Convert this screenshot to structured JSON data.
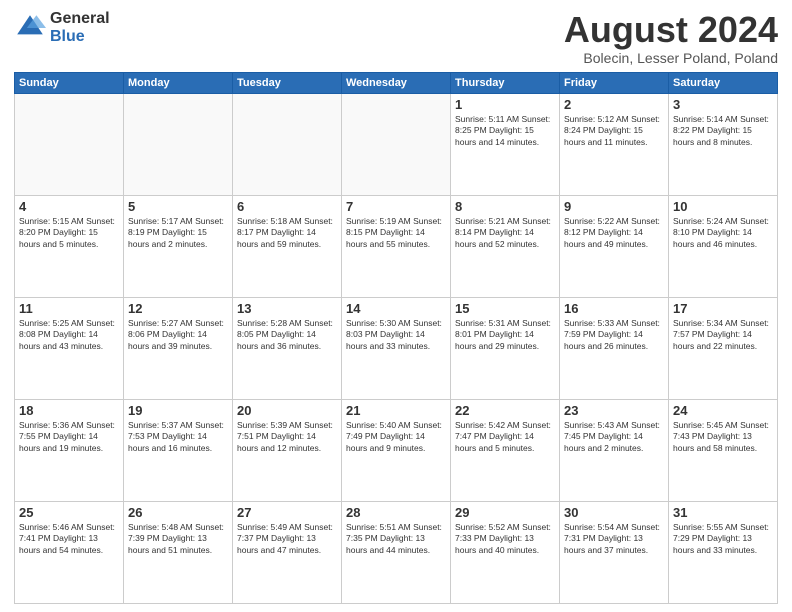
{
  "logo": {
    "general": "General",
    "blue": "Blue"
  },
  "title": {
    "month": "August 2024",
    "location": "Bolecin, Lesser Poland, Poland"
  },
  "weekdays": [
    "Sunday",
    "Monday",
    "Tuesday",
    "Wednesday",
    "Thursday",
    "Friday",
    "Saturday"
  ],
  "weeks": [
    [
      {
        "day": "",
        "info": ""
      },
      {
        "day": "",
        "info": ""
      },
      {
        "day": "",
        "info": ""
      },
      {
        "day": "",
        "info": ""
      },
      {
        "day": "1",
        "info": "Sunrise: 5:11 AM\nSunset: 8:25 PM\nDaylight: 15 hours\nand 14 minutes."
      },
      {
        "day": "2",
        "info": "Sunrise: 5:12 AM\nSunset: 8:24 PM\nDaylight: 15 hours\nand 11 minutes."
      },
      {
        "day": "3",
        "info": "Sunrise: 5:14 AM\nSunset: 8:22 PM\nDaylight: 15 hours\nand 8 minutes."
      }
    ],
    [
      {
        "day": "4",
        "info": "Sunrise: 5:15 AM\nSunset: 8:20 PM\nDaylight: 15 hours\nand 5 minutes."
      },
      {
        "day": "5",
        "info": "Sunrise: 5:17 AM\nSunset: 8:19 PM\nDaylight: 15 hours\nand 2 minutes."
      },
      {
        "day": "6",
        "info": "Sunrise: 5:18 AM\nSunset: 8:17 PM\nDaylight: 14 hours\nand 59 minutes."
      },
      {
        "day": "7",
        "info": "Sunrise: 5:19 AM\nSunset: 8:15 PM\nDaylight: 14 hours\nand 55 minutes."
      },
      {
        "day": "8",
        "info": "Sunrise: 5:21 AM\nSunset: 8:14 PM\nDaylight: 14 hours\nand 52 minutes."
      },
      {
        "day": "9",
        "info": "Sunrise: 5:22 AM\nSunset: 8:12 PM\nDaylight: 14 hours\nand 49 minutes."
      },
      {
        "day": "10",
        "info": "Sunrise: 5:24 AM\nSunset: 8:10 PM\nDaylight: 14 hours\nand 46 minutes."
      }
    ],
    [
      {
        "day": "11",
        "info": "Sunrise: 5:25 AM\nSunset: 8:08 PM\nDaylight: 14 hours\nand 43 minutes."
      },
      {
        "day": "12",
        "info": "Sunrise: 5:27 AM\nSunset: 8:06 PM\nDaylight: 14 hours\nand 39 minutes."
      },
      {
        "day": "13",
        "info": "Sunrise: 5:28 AM\nSunset: 8:05 PM\nDaylight: 14 hours\nand 36 minutes."
      },
      {
        "day": "14",
        "info": "Sunrise: 5:30 AM\nSunset: 8:03 PM\nDaylight: 14 hours\nand 33 minutes."
      },
      {
        "day": "15",
        "info": "Sunrise: 5:31 AM\nSunset: 8:01 PM\nDaylight: 14 hours\nand 29 minutes."
      },
      {
        "day": "16",
        "info": "Sunrise: 5:33 AM\nSunset: 7:59 PM\nDaylight: 14 hours\nand 26 minutes."
      },
      {
        "day": "17",
        "info": "Sunrise: 5:34 AM\nSunset: 7:57 PM\nDaylight: 14 hours\nand 22 minutes."
      }
    ],
    [
      {
        "day": "18",
        "info": "Sunrise: 5:36 AM\nSunset: 7:55 PM\nDaylight: 14 hours\nand 19 minutes."
      },
      {
        "day": "19",
        "info": "Sunrise: 5:37 AM\nSunset: 7:53 PM\nDaylight: 14 hours\nand 16 minutes."
      },
      {
        "day": "20",
        "info": "Sunrise: 5:39 AM\nSunset: 7:51 PM\nDaylight: 14 hours\nand 12 minutes."
      },
      {
        "day": "21",
        "info": "Sunrise: 5:40 AM\nSunset: 7:49 PM\nDaylight: 14 hours\nand 9 minutes."
      },
      {
        "day": "22",
        "info": "Sunrise: 5:42 AM\nSunset: 7:47 PM\nDaylight: 14 hours\nand 5 minutes."
      },
      {
        "day": "23",
        "info": "Sunrise: 5:43 AM\nSunset: 7:45 PM\nDaylight: 14 hours\nand 2 minutes."
      },
      {
        "day": "24",
        "info": "Sunrise: 5:45 AM\nSunset: 7:43 PM\nDaylight: 13 hours\nand 58 minutes."
      }
    ],
    [
      {
        "day": "25",
        "info": "Sunrise: 5:46 AM\nSunset: 7:41 PM\nDaylight: 13 hours\nand 54 minutes."
      },
      {
        "day": "26",
        "info": "Sunrise: 5:48 AM\nSunset: 7:39 PM\nDaylight: 13 hours\nand 51 minutes."
      },
      {
        "day": "27",
        "info": "Sunrise: 5:49 AM\nSunset: 7:37 PM\nDaylight: 13 hours\nand 47 minutes."
      },
      {
        "day": "28",
        "info": "Sunrise: 5:51 AM\nSunset: 7:35 PM\nDaylight: 13 hours\nand 44 minutes."
      },
      {
        "day": "29",
        "info": "Sunrise: 5:52 AM\nSunset: 7:33 PM\nDaylight: 13 hours\nand 40 minutes."
      },
      {
        "day": "30",
        "info": "Sunrise: 5:54 AM\nSunset: 7:31 PM\nDaylight: 13 hours\nand 37 minutes."
      },
      {
        "day": "31",
        "info": "Sunrise: 5:55 AM\nSunset: 7:29 PM\nDaylight: 13 hours\nand 33 minutes."
      }
    ]
  ]
}
